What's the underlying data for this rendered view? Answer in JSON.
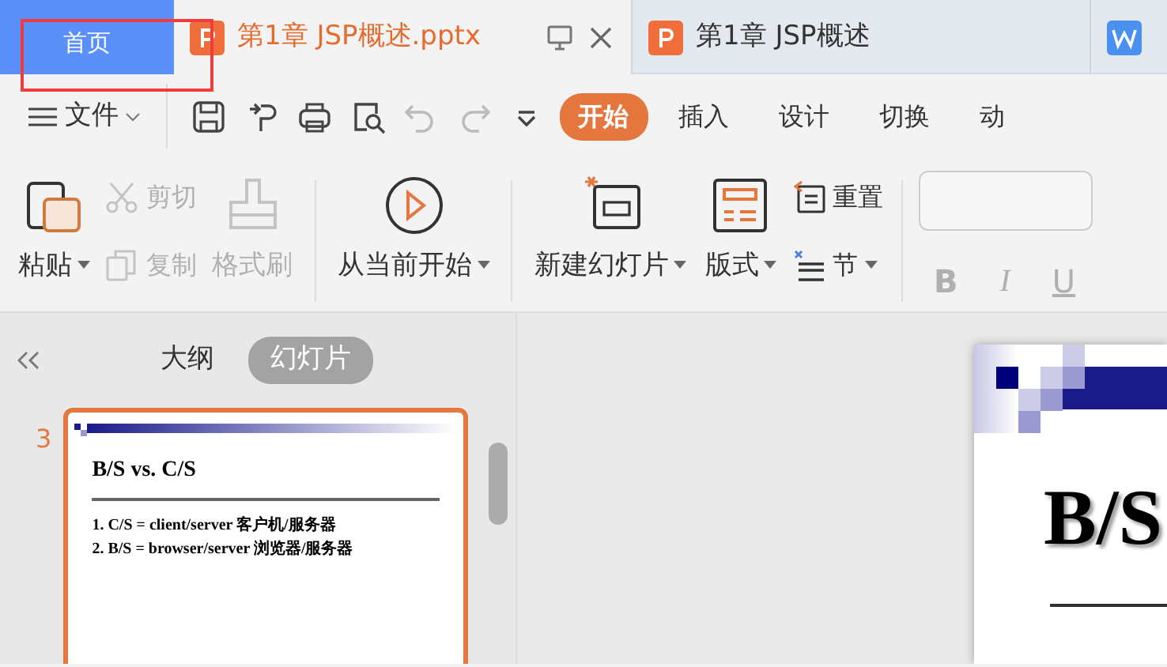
{
  "tabs": [
    {
      "kind": "home",
      "label": "首页",
      "selected": false
    },
    {
      "kind": "doc",
      "label": "第1章 JSP概述.pptx",
      "selected": true
    },
    {
      "kind": "doc",
      "label": "第1章 JSP概述",
      "selected": false
    },
    {
      "kind": "writer"
    }
  ],
  "highlight_frame": true,
  "file_menu": {
    "label": "文件"
  },
  "ribbon_tabs": [
    {
      "label": "开始",
      "selected": true
    },
    {
      "label": "插入",
      "selected": false
    },
    {
      "label": "设计",
      "selected": false
    },
    {
      "label": "切换",
      "selected": false
    },
    {
      "label": "动",
      "selected": false
    }
  ],
  "ribbon": {
    "paste": {
      "label": "粘贴",
      "dropdown": true
    },
    "cut": {
      "label": "剪切",
      "disabled": true
    },
    "copy": {
      "label": "复制",
      "disabled": true
    },
    "format_painter": {
      "label": "格式刷",
      "disabled": true
    },
    "play_from_current": {
      "label": "从当前开始",
      "dropdown": true
    },
    "new_slide": {
      "label": "新建幻灯片",
      "dropdown": true
    },
    "layout": {
      "label": "版式",
      "dropdown": true
    },
    "reset": {
      "label": "重置"
    },
    "section": {
      "label": "节",
      "dropdown": true
    },
    "font_styles": [
      {
        "label": "B",
        "kind": "bold",
        "disabled": true
      },
      {
        "label": "I",
        "kind": "italic",
        "disabled": true
      },
      {
        "label": "U",
        "kind": "underline",
        "disabled": true
      }
    ]
  },
  "sidebar": {
    "views": [
      {
        "label": "大纲",
        "selected": false
      },
      {
        "label": "幻灯片",
        "selected": true
      }
    ],
    "slides": [
      {
        "number": "3",
        "selected": true,
        "title": "B/S vs. C/S",
        "lines": [
          "1. C/S = client/server 客户机/服务器",
          "2. B/S = browser/server 浏览器/服务器"
        ]
      }
    ]
  },
  "editor": {
    "slide_title": "B/S"
  }
}
